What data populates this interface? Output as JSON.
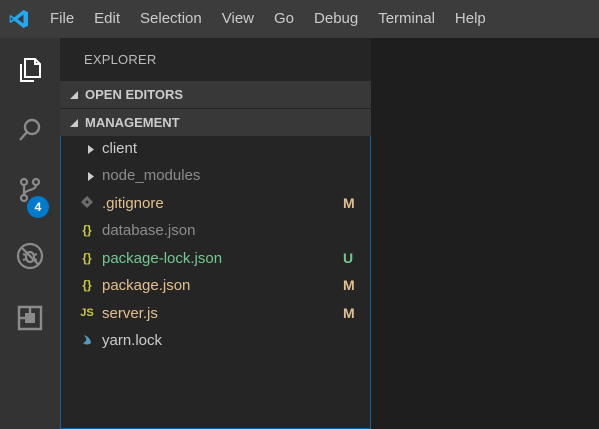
{
  "menu": [
    "File",
    "Edit",
    "Selection",
    "View",
    "Go",
    "Debug",
    "Terminal",
    "Help"
  ],
  "activity": {
    "source_control_badge": "4"
  },
  "sidebar": {
    "title": "EXPLORER",
    "sections": {
      "open_editors": "OPEN EDITORS",
      "management": "MANAGEMENT"
    },
    "files": [
      {
        "name": "client",
        "kind": "folder",
        "status": "",
        "color": "#cccccc"
      },
      {
        "name": "node_modules",
        "kind": "folder",
        "status": "",
        "color": "#8c8c8c"
      },
      {
        "name": ".gitignore",
        "kind": "git",
        "status": "M",
        "color": "#e2c08d"
      },
      {
        "name": "database.json",
        "kind": "json",
        "status": "",
        "color": "#8c8c8c"
      },
      {
        "name": "package-lock.json",
        "kind": "json",
        "status": "U",
        "color": "#73c991"
      },
      {
        "name": "package.json",
        "kind": "json",
        "status": "M",
        "color": "#e2c08d"
      },
      {
        "name": "server.js",
        "kind": "js",
        "status": "M",
        "color": "#e2c08d"
      },
      {
        "name": "yarn.lock",
        "kind": "yarn",
        "status": "",
        "color": "#cccccc"
      }
    ]
  },
  "colors": {
    "accent": "#007acc",
    "modified": "#e2c08d",
    "untracked": "#73c991"
  }
}
